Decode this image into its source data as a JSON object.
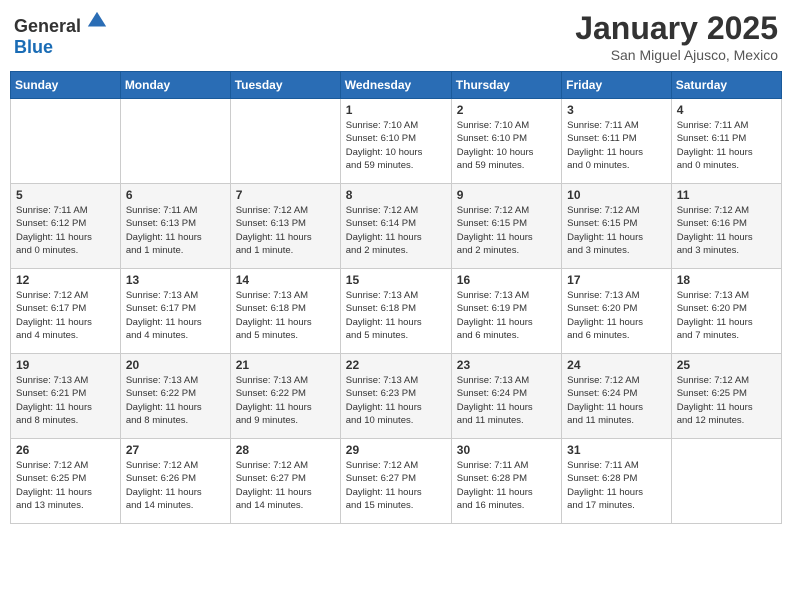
{
  "header": {
    "logo_general": "General",
    "logo_blue": "Blue",
    "month": "January 2025",
    "location": "San Miguel Ajusco, Mexico"
  },
  "days_of_week": [
    "Sunday",
    "Monday",
    "Tuesday",
    "Wednesday",
    "Thursday",
    "Friday",
    "Saturday"
  ],
  "weeks": [
    [
      {
        "day": "",
        "info": ""
      },
      {
        "day": "",
        "info": ""
      },
      {
        "day": "",
        "info": ""
      },
      {
        "day": "1",
        "info": "Sunrise: 7:10 AM\nSunset: 6:10 PM\nDaylight: 10 hours\nand 59 minutes."
      },
      {
        "day": "2",
        "info": "Sunrise: 7:10 AM\nSunset: 6:10 PM\nDaylight: 10 hours\nand 59 minutes."
      },
      {
        "day": "3",
        "info": "Sunrise: 7:11 AM\nSunset: 6:11 PM\nDaylight: 11 hours\nand 0 minutes."
      },
      {
        "day": "4",
        "info": "Sunrise: 7:11 AM\nSunset: 6:11 PM\nDaylight: 11 hours\nand 0 minutes."
      }
    ],
    [
      {
        "day": "5",
        "info": "Sunrise: 7:11 AM\nSunset: 6:12 PM\nDaylight: 11 hours\nand 0 minutes."
      },
      {
        "day": "6",
        "info": "Sunrise: 7:11 AM\nSunset: 6:13 PM\nDaylight: 11 hours\nand 1 minute."
      },
      {
        "day": "7",
        "info": "Sunrise: 7:12 AM\nSunset: 6:13 PM\nDaylight: 11 hours\nand 1 minute."
      },
      {
        "day": "8",
        "info": "Sunrise: 7:12 AM\nSunset: 6:14 PM\nDaylight: 11 hours\nand 2 minutes."
      },
      {
        "day": "9",
        "info": "Sunrise: 7:12 AM\nSunset: 6:15 PM\nDaylight: 11 hours\nand 2 minutes."
      },
      {
        "day": "10",
        "info": "Sunrise: 7:12 AM\nSunset: 6:15 PM\nDaylight: 11 hours\nand 3 minutes."
      },
      {
        "day": "11",
        "info": "Sunrise: 7:12 AM\nSunset: 6:16 PM\nDaylight: 11 hours\nand 3 minutes."
      }
    ],
    [
      {
        "day": "12",
        "info": "Sunrise: 7:12 AM\nSunset: 6:17 PM\nDaylight: 11 hours\nand 4 minutes."
      },
      {
        "day": "13",
        "info": "Sunrise: 7:13 AM\nSunset: 6:17 PM\nDaylight: 11 hours\nand 4 minutes."
      },
      {
        "day": "14",
        "info": "Sunrise: 7:13 AM\nSunset: 6:18 PM\nDaylight: 11 hours\nand 5 minutes."
      },
      {
        "day": "15",
        "info": "Sunrise: 7:13 AM\nSunset: 6:18 PM\nDaylight: 11 hours\nand 5 minutes."
      },
      {
        "day": "16",
        "info": "Sunrise: 7:13 AM\nSunset: 6:19 PM\nDaylight: 11 hours\nand 6 minutes."
      },
      {
        "day": "17",
        "info": "Sunrise: 7:13 AM\nSunset: 6:20 PM\nDaylight: 11 hours\nand 6 minutes."
      },
      {
        "day": "18",
        "info": "Sunrise: 7:13 AM\nSunset: 6:20 PM\nDaylight: 11 hours\nand 7 minutes."
      }
    ],
    [
      {
        "day": "19",
        "info": "Sunrise: 7:13 AM\nSunset: 6:21 PM\nDaylight: 11 hours\nand 8 minutes."
      },
      {
        "day": "20",
        "info": "Sunrise: 7:13 AM\nSunset: 6:22 PM\nDaylight: 11 hours\nand 8 minutes."
      },
      {
        "day": "21",
        "info": "Sunrise: 7:13 AM\nSunset: 6:22 PM\nDaylight: 11 hours\nand 9 minutes."
      },
      {
        "day": "22",
        "info": "Sunrise: 7:13 AM\nSunset: 6:23 PM\nDaylight: 11 hours\nand 10 minutes."
      },
      {
        "day": "23",
        "info": "Sunrise: 7:13 AM\nSunset: 6:24 PM\nDaylight: 11 hours\nand 11 minutes."
      },
      {
        "day": "24",
        "info": "Sunrise: 7:12 AM\nSunset: 6:24 PM\nDaylight: 11 hours\nand 11 minutes."
      },
      {
        "day": "25",
        "info": "Sunrise: 7:12 AM\nSunset: 6:25 PM\nDaylight: 11 hours\nand 12 minutes."
      }
    ],
    [
      {
        "day": "26",
        "info": "Sunrise: 7:12 AM\nSunset: 6:25 PM\nDaylight: 11 hours\nand 13 minutes."
      },
      {
        "day": "27",
        "info": "Sunrise: 7:12 AM\nSunset: 6:26 PM\nDaylight: 11 hours\nand 14 minutes."
      },
      {
        "day": "28",
        "info": "Sunrise: 7:12 AM\nSunset: 6:27 PM\nDaylight: 11 hours\nand 14 minutes."
      },
      {
        "day": "29",
        "info": "Sunrise: 7:12 AM\nSunset: 6:27 PM\nDaylight: 11 hours\nand 15 minutes."
      },
      {
        "day": "30",
        "info": "Sunrise: 7:11 AM\nSunset: 6:28 PM\nDaylight: 11 hours\nand 16 minutes."
      },
      {
        "day": "31",
        "info": "Sunrise: 7:11 AM\nSunset: 6:28 PM\nDaylight: 11 hours\nand 17 minutes."
      },
      {
        "day": "",
        "info": ""
      }
    ]
  ]
}
